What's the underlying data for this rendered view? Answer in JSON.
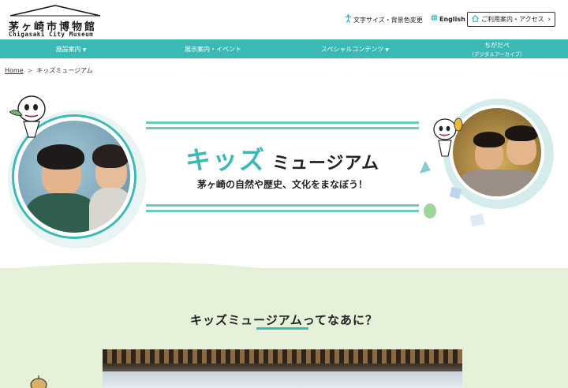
{
  "header": {
    "logo_ja": "茅ヶ崎市博物館",
    "logo_en": "Chigasaki City Museum",
    "font_setting": "文字サイズ・背景色変更",
    "language": "English",
    "access_button": "ご利用案内・アクセス"
  },
  "nav": {
    "items": [
      {
        "label": "施設案内",
        "dropdown": true
      },
      {
        "label": "展示案内・イベント",
        "dropdown": false
      },
      {
        "label": "スペシャルコンテンツ",
        "dropdown": true
      },
      {
        "label": "ちがだぺ",
        "sublabel": "（デジタルアーカイブ）"
      }
    ]
  },
  "breadcrumb": {
    "home": "Home",
    "current": "キッズミュージアム"
  },
  "hero": {
    "title_kids": "キッズ",
    "title_museum": "ミュージアム",
    "subtitle": "茅ヶ崎の自然や歴史、文化をまなぼう！"
  },
  "section": {
    "title": "キッズミュージアムってなあに？"
  },
  "colors": {
    "teal": "#3bbab5",
    "light_green": "#e6f1da",
    "dark_text": "#222222"
  },
  "icons": [
    "accessibility-icon",
    "globe-icon",
    "home-icon",
    "chevron-right-icon",
    "caret-down-icon"
  ]
}
